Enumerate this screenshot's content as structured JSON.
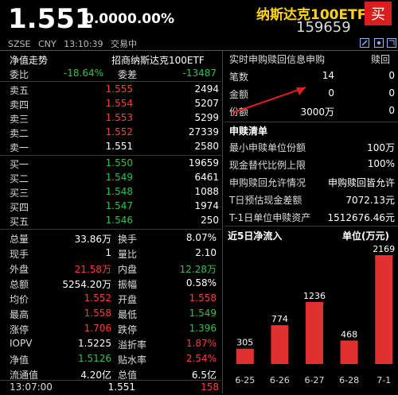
{
  "header": {
    "last_price": "1.551",
    "change": "0.000",
    "change_pct": "0.00%",
    "name": "纳斯达克100ETF",
    "code": "159659",
    "buy_label": "买",
    "exchange": "SZSE",
    "currency": "CNY",
    "time": "13:10:39",
    "status": "交易中"
  },
  "left": {
    "title": "净值走势",
    "fund_name": "招商纳斯达克100ETF",
    "weibi_label": "委比",
    "weibi_value": "-18.64%",
    "weicha_label": "委差",
    "weicha_value": "-13487",
    "sells": [
      {
        "label": "卖五",
        "price": "1.555",
        "vol": "2494"
      },
      {
        "label": "卖四",
        "price": "1.554",
        "vol": "5207"
      },
      {
        "label": "卖三",
        "price": "1.553",
        "vol": "5299"
      },
      {
        "label": "卖二",
        "price": "1.552",
        "vol": "27339"
      },
      {
        "label": "卖一",
        "price": "1.551",
        "vol": "2580"
      }
    ],
    "buys": [
      {
        "label": "买一",
        "price": "1.550",
        "vol": "19659"
      },
      {
        "label": "买二",
        "price": "1.549",
        "vol": "6461"
      },
      {
        "label": "买三",
        "price": "1.548",
        "vol": "1088"
      },
      {
        "label": "买四",
        "price": "1.547",
        "vol": "1974"
      },
      {
        "label": "买五",
        "price": "1.546",
        "vol": "250"
      }
    ],
    "stats": [
      {
        "l1": "总量",
        "v1": "33.86万",
        "c1": "white",
        "l2": "换手",
        "v2": "8.07%",
        "c2": "white"
      },
      {
        "l1": "现手",
        "v1": "1",
        "c1": "white",
        "l2": "量比",
        "v2": "2.10",
        "c2": "white"
      },
      {
        "l1": "外盘",
        "v1": "21.58万",
        "c1": "red",
        "l2": "内盘",
        "v2": "12.28万",
        "c2": "green"
      },
      {
        "l1": "总额",
        "v1": "5254.20万",
        "c1": "white",
        "l2": "振幅",
        "v2": "0.58%",
        "c2": "white"
      },
      {
        "l1": "均价",
        "v1": "1.552",
        "c1": "red",
        "l2": "开盘",
        "v2": "1.558",
        "c2": "red"
      },
      {
        "l1": "最高",
        "v1": "1.558",
        "c1": "red",
        "l2": "最低",
        "v2": "1.549",
        "c2": "green"
      },
      {
        "l1": "涨停",
        "v1": "1.706",
        "c1": "red",
        "l2": "跌停",
        "v2": "1.396",
        "c2": "green"
      },
      {
        "l1": "IOPV",
        "v1": "1.5225",
        "c1": "white",
        "l2": "溢折率",
        "v2": "1.87%",
        "c2": "red"
      },
      {
        "l1": "净值",
        "v1": "1.5126",
        "c1": "green",
        "l2": "贴水率",
        "v2": "2.54%",
        "c2": "red"
      },
      {
        "l1": "流通值",
        "v1": "4.20亿",
        "c1": "white",
        "l2": "总值",
        "v2": "6.5亿",
        "c2": "white"
      }
    ],
    "tick": {
      "time": "13:07:00",
      "price": "1.551",
      "vol": "158"
    }
  },
  "right": {
    "realtime_title": "实时申购赎回信息申购",
    "realtime_redeem_label": "赎回",
    "rt_rows": [
      {
        "label": "笔数",
        "sub": "14",
        "red": "0"
      },
      {
        "label": "金额",
        "sub": "0",
        "red": "0"
      },
      {
        "label": "份额",
        "sub": "3000万",
        "red": "0"
      }
    ],
    "list_title": "申赎清单",
    "list_rows": [
      {
        "label": "最小申赎单位份额",
        "value": "100万"
      },
      {
        "label": "现金替代比例上限",
        "value": "100%"
      },
      {
        "label": "申购赎回允许情况",
        "value": "申购赎回皆允许"
      },
      {
        "label": "T日预估现金差额",
        "value": "7072.13元"
      },
      {
        "label": "T-1日单位申赎资产",
        "value": "1512676.46元"
      }
    ],
    "flow_title": "近5日净流入",
    "flow_unit": "单位(万元)"
  },
  "chart_data": {
    "type": "bar",
    "title": "近5日净流入",
    "ylabel": "单位(万元)",
    "categories": [
      "6-25",
      "6-26",
      "6-27",
      "6-28",
      "7-1"
    ],
    "values": [
      305,
      774,
      1236,
      468,
      2169
    ],
    "ylim": [
      0,
      2169
    ],
    "bar_color": "#e03030"
  },
  "colors": {
    "red": "#ff3b3b",
    "green": "#2ec24a",
    "gold": "#ffd700",
    "buy_button": "#d81e1e",
    "background": "#000000"
  }
}
